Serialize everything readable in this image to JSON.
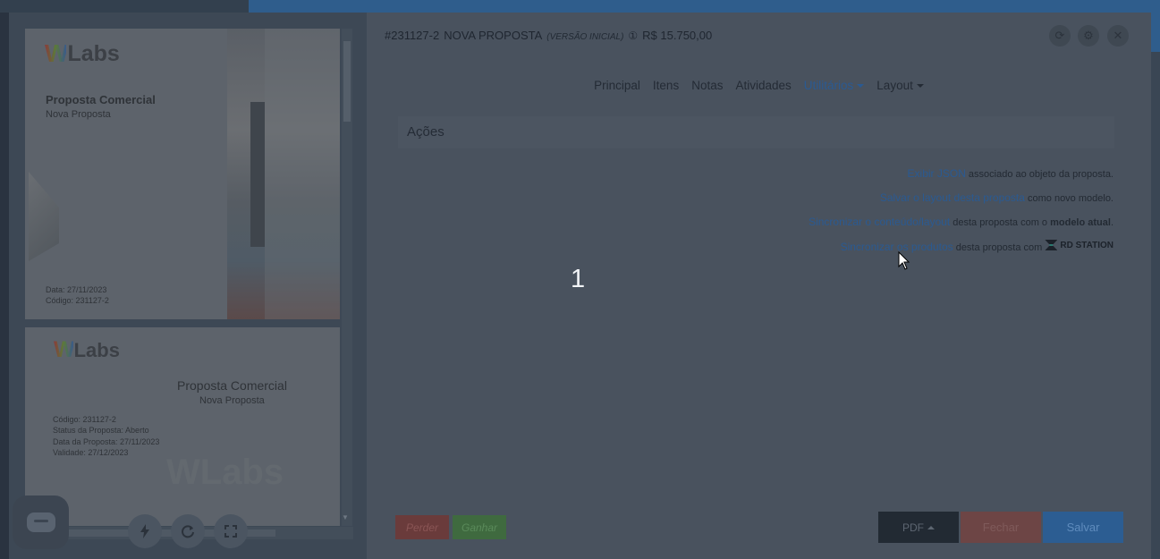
{
  "preview": {
    "page1": {
      "logo": "Labs",
      "logo_mark": "W",
      "title": "Proposta Comercial",
      "subtitle": "Nova Proposta",
      "date": "Data: 27/11/2023",
      "code": "Código: 231127-2"
    },
    "page2": {
      "logo": "Labs",
      "logo_mark": "W",
      "title": "Proposta Comercial",
      "subtitle": "Nova Proposta",
      "code": "Código:  231127-2",
      "status": "Status da Proposta:  Aberto",
      "date": "Data da Proposta:  27/11/2023",
      "validity": "Validade:  27/12/2023",
      "watermark": "WLabs"
    },
    "controls": [
      "bolt-icon",
      "refresh-icon",
      "fullscreen-icon"
    ]
  },
  "modal": {
    "header": {
      "id": "#231127-2",
      "name": "NOVA PROPOSTA",
      "version": "(VERSÃO INICIAL)",
      "coin_icon": "①",
      "amount": "R$ 15.750,00"
    },
    "nav": [
      {
        "label": "Principal",
        "active": false
      },
      {
        "label": "Itens",
        "active": false
      },
      {
        "label": "Notas",
        "active": false
      },
      {
        "label": "Atividades",
        "active": false
      },
      {
        "label": "Utilitários",
        "active": true
      },
      {
        "label": "Layout",
        "active": false
      }
    ],
    "section_title": "Ações",
    "actions": [
      {
        "link": "Exibir JSON",
        "desc": " associado ao objeto da proposta."
      },
      {
        "link": "Salvar o layout desta proposta",
        "desc": " como novo modelo."
      },
      {
        "link": "Sincronizar o conteúdo/layout",
        "desc": " desta proposta com o ",
        "bold": "modelo atual",
        "tail": "."
      },
      {
        "link": "Sincronizar os produtos",
        "desc": " desta proposta com ",
        "brand": "RD STATION"
      }
    ],
    "step_number": "1",
    "buttons": {
      "perder": "Perder",
      "ganhar": "Ganhar",
      "pdf": "PDF",
      "fechar": "Fechar",
      "salvar": "Salvar"
    }
  }
}
